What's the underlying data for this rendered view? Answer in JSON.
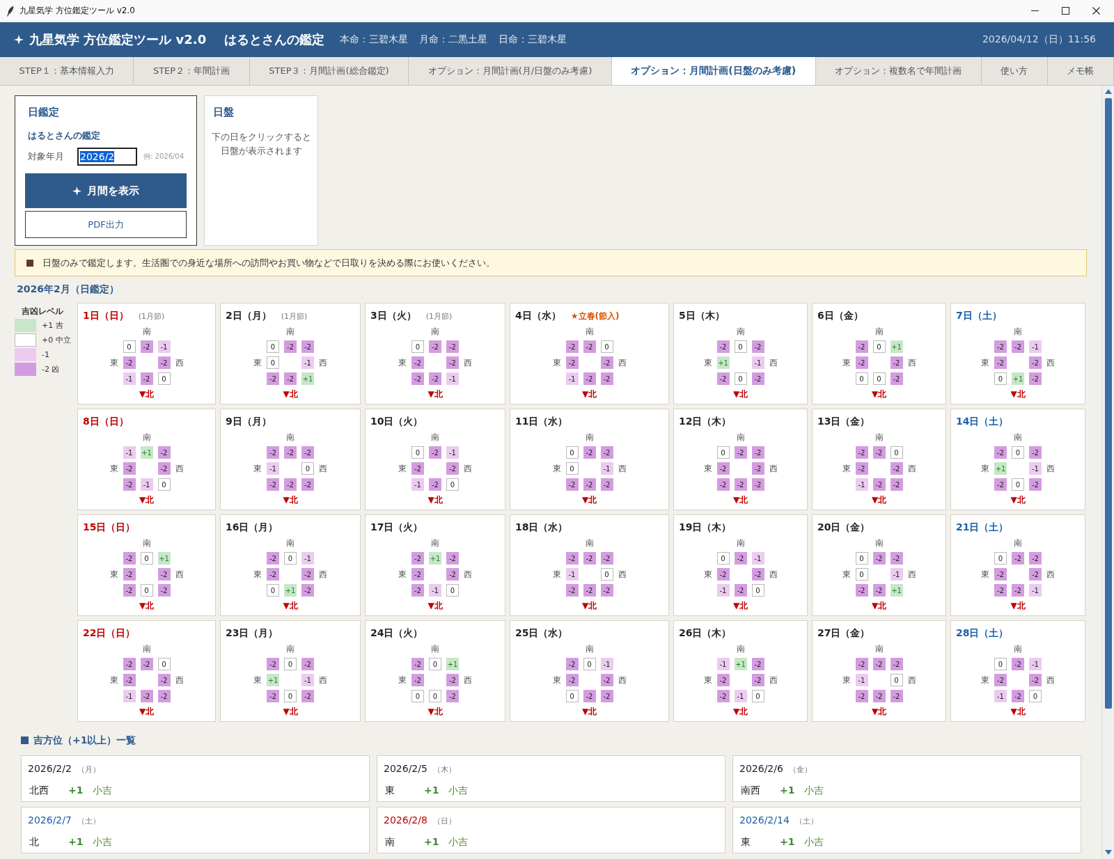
{
  "window": {
    "title": "九星気学 方位鑑定ツール v2.0"
  },
  "header": {
    "app_title": "九星気学 方位鑑定ツール v2.0",
    "subject": "はるとさんの鑑定",
    "stars": [
      "本命：三碧木星",
      "月命：二黒土星",
      "日命：三碧木星"
    ],
    "datetime": "2026/04/12（日）11:56"
  },
  "tabs": [
    {
      "label": "STEP１：基本情報入力",
      "selected": false
    },
    {
      "label": "STEP２：年間計画",
      "selected": false
    },
    {
      "label": "STEP３：月間計画(総合鑑定)",
      "selected": false
    },
    {
      "label": "オプション：月間計画(月/日盤のみ考慮)",
      "selected": false
    },
    {
      "label": "オプション：月間計画(日盤のみ考慮)",
      "selected": true
    },
    {
      "label": "オプション：複数名で年間計画",
      "selected": false
    },
    {
      "label": "使い方",
      "selected": false
    },
    {
      "label": "メモ帳",
      "selected": false
    }
  ],
  "control_panel": {
    "title": "日鑑定",
    "subject": "はるとさんの鑑定",
    "month_label": "対象年月",
    "month_value": "2026/2",
    "text_selected": true,
    "month_hint": "例: 2026/04",
    "buttons": [
      {
        "label": "月間を表示",
        "kind": "primary"
      },
      {
        "label": "PDF出力",
        "kind": "secondary"
      }
    ]
  },
  "board_panel": {
    "title": "日盤",
    "message_lines": [
      "下の日をクリックすると",
      "日盤が表示されます"
    ]
  },
  "notice": "日盤のみで鑑定します。生活圏での身近な場所への訪問やお買い物などで日取りを決める際にお使いください。",
  "calendar": {
    "title": "2026年2月（日鑑定）",
    "legend": {
      "title": "吉凶レベル",
      "items": [
        {
          "label": "+1 吉",
          "kind": "good"
        },
        {
          "label": "+0 中立",
          "kind": "neutral"
        },
        {
          "label": "-1",
          "kind": "minor"
        },
        {
          "label": "-2 凶",
          "kind": "bad"
        }
      ]
    },
    "days": [
      {
        "label": "1日（日）",
        "kind": "sunday",
        "note": {
          "text": "(1月節)",
          "kind": "period"
        },
        "south": "南",
        "east": "東",
        "west": "西",
        "north": "▼北",
        "cells": [
          {
            "text": "0",
            "kind": "neutral"
          },
          {
            "text": "-2",
            "kind": "bad"
          },
          {
            "text": "-1",
            "kind": "minor"
          },
          {
            "text": "-2",
            "kind": "bad"
          },
          {
            "text": "-2",
            "kind": "bad"
          },
          {
            "text": "-1",
            "kind": "minor"
          },
          {
            "text": "-2",
            "kind": "bad"
          },
          {
            "text": "0",
            "kind": "neutral"
          }
        ]
      },
      {
        "label": "2日（月）",
        "kind": "weekday",
        "note": {
          "text": "(1月節)",
          "kind": "period"
        },
        "south": "南",
        "east": "東",
        "west": "西",
        "north": "▼北",
        "cells": [
          {
            "text": "0",
            "kind": "neutral"
          },
          {
            "text": "-2",
            "kind": "bad"
          },
          {
            "text": "-2",
            "kind": "bad"
          },
          {
            "text": "0",
            "kind": "neutral"
          },
          {
            "text": "-1",
            "kind": "minor"
          },
          {
            "text": "-2",
            "kind": "bad"
          },
          {
            "text": "-2",
            "kind": "bad"
          },
          {
            "text": "+1",
            "kind": "good"
          }
        ]
      },
      {
        "label": "3日（火）",
        "kind": "weekday",
        "note": {
          "text": "(1月節)",
          "kind": "period"
        },
        "south": "南",
        "east": "東",
        "west": "西",
        "north": "▼北",
        "cells": [
          {
            "text": "0",
            "kind": "neutral"
          },
          {
            "text": "-2",
            "kind": "bad"
          },
          {
            "text": "-2",
            "kind": "bad"
          },
          {
            "text": "-2",
            "kind": "bad"
          },
          {
            "text": "-2",
            "kind": "bad"
          },
          {
            "text": "-2",
            "kind": "bad"
          },
          {
            "text": "-2",
            "kind": "bad"
          },
          {
            "text": "-1",
            "kind": "minor"
          }
        ]
      },
      {
        "label": "4日（水）",
        "kind": "weekday",
        "note": {
          "text": "★立春(節入)",
          "kind": "event"
        },
        "south": "南",
        "east": "東",
        "west": "西",
        "north": "▼北",
        "cells": [
          {
            "text": "-2",
            "kind": "bad"
          },
          {
            "text": "-2",
            "kind": "bad"
          },
          {
            "text": "0",
            "kind": "neutral"
          },
          {
            "text": "-2",
            "kind": "bad"
          },
          {
            "text": "-2",
            "kind": "bad"
          },
          {
            "text": "-1",
            "kind": "minor"
          },
          {
            "text": "-2",
            "kind": "bad"
          },
          {
            "text": "-2",
            "kind": "bad"
          }
        ]
      },
      {
        "label": "5日（木）",
        "kind": "weekday",
        "south": "南",
        "east": "東",
        "west": "西",
        "north": "▼北",
        "cells": [
          {
            "text": "-2",
            "kind": "bad"
          },
          {
            "text": "0",
            "kind": "neutral"
          },
          {
            "text": "-2",
            "kind": "bad"
          },
          {
            "text": "+1",
            "kind": "good"
          },
          {
            "text": "-1",
            "kind": "minor"
          },
          {
            "text": "-2",
            "kind": "bad"
          },
          {
            "text": "0",
            "kind": "neutral"
          },
          {
            "text": "-2",
            "kind": "bad"
          }
        ]
      },
      {
        "label": "6日（金）",
        "kind": "weekday",
        "south": "南",
        "east": "東",
        "west": "西",
        "north": "▼北",
        "cells": [
          {
            "text": "-2",
            "kind": "bad"
          },
          {
            "text": "0",
            "kind": "neutral"
          },
          {
            "text": "+1",
            "kind": "good"
          },
          {
            "text": "-2",
            "kind": "bad"
          },
          {
            "text": "-2",
            "kind": "bad"
          },
          {
            "text": "0",
            "kind": "neutral"
          },
          {
            "text": "0",
            "kind": "neutral"
          },
          {
            "text": "-2",
            "kind": "bad"
          }
        ]
      },
      {
        "label": "7日（土）",
        "kind": "saturday",
        "south": "南",
        "east": "東",
        "west": "西",
        "north": "▼北",
        "cells": [
          {
            "text": "-2",
            "kind": "bad"
          },
          {
            "text": "-2",
            "kind": "bad"
          },
          {
            "text": "-1",
            "kind": "minor"
          },
          {
            "text": "-2",
            "kind": "bad"
          },
          {
            "text": "-2",
            "kind": "bad"
          },
          {
            "text": "0",
            "kind": "neutral"
          },
          {
            "text": "+1",
            "kind": "good"
          },
          {
            "text": "-2",
            "kind": "bad"
          }
        ]
      },
      {
        "label": "8日（日）",
        "kind": "sunday",
        "south": "南",
        "east": "東",
        "west": "西",
        "north": "▼北",
        "cells": [
          {
            "text": "-1",
            "kind": "minor"
          },
          {
            "text": "+1",
            "kind": "good"
          },
          {
            "text": "-2",
            "kind": "bad"
          },
          {
            "text": "-2",
            "kind": "bad"
          },
          {
            "text": "-2",
            "kind": "bad"
          },
          {
            "text": "-2",
            "kind": "bad"
          },
          {
            "text": "-1",
            "kind": "minor"
          },
          {
            "text": "0",
            "kind": "neutral"
          }
        ]
      },
      {
        "label": "9日（月）",
        "kind": "weekday",
        "south": "南",
        "east": "東",
        "west": "西",
        "north": "▼北",
        "cells": [
          {
            "text": "-2",
            "kind": "bad"
          },
          {
            "text": "-2",
            "kind": "bad"
          },
          {
            "text": "-2",
            "kind": "bad"
          },
          {
            "text": "-1",
            "kind": "minor"
          },
          {
            "text": "0",
            "kind": "neutral"
          },
          {
            "text": "-2",
            "kind": "bad"
          },
          {
            "text": "-2",
            "kind": "bad"
          },
          {
            "text": "-2",
            "kind": "bad"
          }
        ]
      },
      {
        "label": "10日（火）",
        "kind": "weekday",
        "south": "南",
        "east": "東",
        "west": "西",
        "north": "▼北",
        "cells": [
          {
            "text": "0",
            "kind": "neutral"
          },
          {
            "text": "-2",
            "kind": "bad"
          },
          {
            "text": "-1",
            "kind": "minor"
          },
          {
            "text": "-2",
            "kind": "bad"
          },
          {
            "text": "-2",
            "kind": "bad"
          },
          {
            "text": "-1",
            "kind": "minor"
          },
          {
            "text": "-2",
            "kind": "bad"
          },
          {
            "text": "0",
            "kind": "neutral"
          }
        ]
      },
      {
        "label": "11日（水）",
        "kind": "weekday",
        "south": "南",
        "east": "東",
        "west": "西",
        "north": "▼北",
        "cells": [
          {
            "text": "0",
            "kind": "neutral"
          },
          {
            "text": "-2",
            "kind": "bad"
          },
          {
            "text": "-2",
            "kind": "bad"
          },
          {
            "text": "0",
            "kind": "neutral"
          },
          {
            "text": "-1",
            "kind": "minor"
          },
          {
            "text": "-2",
            "kind": "bad"
          },
          {
            "text": "-2",
            "kind": "bad"
          },
          {
            "text": "-2",
            "kind": "bad"
          }
        ]
      },
      {
        "label": "12日（木）",
        "kind": "weekday",
        "south": "南",
        "east": "東",
        "west": "西",
        "north": "▼北",
        "cells": [
          {
            "text": "0",
            "kind": "neutral"
          },
          {
            "text": "-2",
            "kind": "bad"
          },
          {
            "text": "-2",
            "kind": "bad"
          },
          {
            "text": "-2",
            "kind": "bad"
          },
          {
            "text": "-2",
            "kind": "bad"
          },
          {
            "text": "-2",
            "kind": "bad"
          },
          {
            "text": "-2",
            "kind": "bad"
          },
          {
            "text": "-2",
            "kind": "bad"
          }
        ]
      },
      {
        "label": "13日（金）",
        "kind": "weekday",
        "south": "南",
        "east": "東",
        "west": "西",
        "north": "▼北",
        "cells": [
          {
            "text": "-2",
            "kind": "bad"
          },
          {
            "text": "-2",
            "kind": "bad"
          },
          {
            "text": "0",
            "kind": "neutral"
          },
          {
            "text": "-2",
            "kind": "bad"
          },
          {
            "text": "-2",
            "kind": "bad"
          },
          {
            "text": "-1",
            "kind": "minor"
          },
          {
            "text": "-2",
            "kind": "bad"
          },
          {
            "text": "-2",
            "kind": "bad"
          }
        ]
      },
      {
        "label": "14日（土）",
        "kind": "saturday",
        "south": "南",
        "east": "東",
        "west": "西",
        "north": "▼北",
        "cells": [
          {
            "text": "-2",
            "kind": "bad"
          },
          {
            "text": "0",
            "kind": "neutral"
          },
          {
            "text": "-2",
            "kind": "bad"
          },
          {
            "text": "+1",
            "kind": "good"
          },
          {
            "text": "-1",
            "kind": "minor"
          },
          {
            "text": "-2",
            "kind": "bad"
          },
          {
            "text": "0",
            "kind": "neutral"
          },
          {
            "text": "-2",
            "kind": "bad"
          }
        ]
      },
      {
        "label": "15日（日）",
        "kind": "sunday",
        "south": "南",
        "east": "東",
        "west": "西",
        "north": "▼北",
        "cells": [
          {
            "text": "-2",
            "kind": "bad"
          },
          {
            "text": "0",
            "kind": "neutral"
          },
          {
            "text": "+1",
            "kind": "good"
          },
          {
            "text": "-2",
            "kind": "bad"
          },
          {
            "text": "-2",
            "kind": "bad"
          },
          {
            "text": "-2",
            "kind": "bad"
          },
          {
            "text": "0",
            "kind": "neutral"
          },
          {
            "text": "-2",
            "kind": "bad"
          }
        ]
      },
      {
        "label": "16日（月）",
        "kind": "weekday",
        "south": "南",
        "east": "東",
        "west": "西",
        "north": "▼北",
        "cells": [
          {
            "text": "-2",
            "kind": "bad"
          },
          {
            "text": "0",
            "kind": "neutral"
          },
          {
            "text": "-1",
            "kind": "minor"
          },
          {
            "text": "-2",
            "kind": "bad"
          },
          {
            "text": "-2",
            "kind": "bad"
          },
          {
            "text": "0",
            "kind": "neutral"
          },
          {
            "text": "+1",
            "kind": "good"
          },
          {
            "text": "-2",
            "kind": "bad"
          }
        ]
      },
      {
        "label": "17日（火）",
        "kind": "weekday",
        "south": "南",
        "east": "東",
        "west": "西",
        "north": "▼北",
        "cells": [
          {
            "text": "-2",
            "kind": "bad"
          },
          {
            "text": "+1",
            "kind": "good"
          },
          {
            "text": "-2",
            "kind": "bad"
          },
          {
            "text": "-2",
            "kind": "bad"
          },
          {
            "text": "-2",
            "kind": "bad"
          },
          {
            "text": "-2",
            "kind": "bad"
          },
          {
            "text": "-1",
            "kind": "minor"
          },
          {
            "text": "0",
            "kind": "neutral"
          }
        ]
      },
      {
        "label": "18日（水）",
        "kind": "weekday",
        "south": "南",
        "east": "東",
        "west": "西",
        "north": "▼北",
        "cells": [
          {
            "text": "-2",
            "kind": "bad"
          },
          {
            "text": "-2",
            "kind": "bad"
          },
          {
            "text": "-2",
            "kind": "bad"
          },
          {
            "text": "-1",
            "kind": "minor"
          },
          {
            "text": "0",
            "kind": "neutral"
          },
          {
            "text": "-2",
            "kind": "bad"
          },
          {
            "text": "-2",
            "kind": "bad"
          },
          {
            "text": "-2",
            "kind": "bad"
          }
        ]
      },
      {
        "label": "19日（木）",
        "kind": "weekday",
        "south": "南",
        "east": "東",
        "west": "西",
        "north": "▼北",
        "cells": [
          {
            "text": "0",
            "kind": "neutral"
          },
          {
            "text": "-2",
            "kind": "bad"
          },
          {
            "text": "-1",
            "kind": "minor"
          },
          {
            "text": "-2",
            "kind": "bad"
          },
          {
            "text": "-2",
            "kind": "bad"
          },
          {
            "text": "-1",
            "kind": "minor"
          },
          {
            "text": "-2",
            "kind": "bad"
          },
          {
            "text": "0",
            "kind": "neutral"
          }
        ]
      },
      {
        "label": "20日（金）",
        "kind": "weekday",
        "south": "南",
        "east": "東",
        "west": "西",
        "north": "▼北",
        "cells": [
          {
            "text": "0",
            "kind": "neutral"
          },
          {
            "text": "-2",
            "kind": "bad"
          },
          {
            "text": "-2",
            "kind": "bad"
          },
          {
            "text": "0",
            "kind": "neutral"
          },
          {
            "text": "-1",
            "kind": "minor"
          },
          {
            "text": "-2",
            "kind": "bad"
          },
          {
            "text": "-2",
            "kind": "bad"
          },
          {
            "text": "+1",
            "kind": "good"
          }
        ]
      },
      {
        "label": "21日（土）",
        "kind": "saturday",
        "south": "南",
        "east": "東",
        "west": "西",
        "north": "▼北",
        "cells": [
          {
            "text": "0",
            "kind": "neutral"
          },
          {
            "text": "-2",
            "kind": "bad"
          },
          {
            "text": "-2",
            "kind": "bad"
          },
          {
            "text": "-2",
            "kind": "bad"
          },
          {
            "text": "-2",
            "kind": "bad"
          },
          {
            "text": "-2",
            "kind": "bad"
          },
          {
            "text": "-2",
            "kind": "bad"
          },
          {
            "text": "-1",
            "kind": "minor"
          }
        ]
      },
      {
        "label": "22日（日）",
        "kind": "sunday",
        "south": "南",
        "east": "東",
        "west": "西",
        "north": "▼北",
        "cells": [
          {
            "text": "-2",
            "kind": "bad"
          },
          {
            "text": "-2",
            "kind": "bad"
          },
          {
            "text": "0",
            "kind": "neutral"
          },
          {
            "text": "-2",
            "kind": "bad"
          },
          {
            "text": "-2",
            "kind": "bad"
          },
          {
            "text": "-1",
            "kind": "minor"
          },
          {
            "text": "-2",
            "kind": "bad"
          },
          {
            "text": "-2",
            "kind": "bad"
          }
        ]
      },
      {
        "label": "23日（月）",
        "kind": "weekday",
        "south": "南",
        "east": "東",
        "west": "西",
        "north": "▼北",
        "cells": [
          {
            "text": "-2",
            "kind": "bad"
          },
          {
            "text": "0",
            "kind": "neutral"
          },
          {
            "text": "-2",
            "kind": "bad"
          },
          {
            "text": "+1",
            "kind": "good"
          },
          {
            "text": "-1",
            "kind": "minor"
          },
          {
            "text": "-2",
            "kind": "bad"
          },
          {
            "text": "0",
            "kind": "neutral"
          },
          {
            "text": "-2",
            "kind": "bad"
          }
        ]
      },
      {
        "label": "24日（火）",
        "kind": "weekday",
        "south": "南",
        "east": "東",
        "west": "西",
        "north": "▼北",
        "cells": [
          {
            "text": "-2",
            "kind": "bad"
          },
          {
            "text": "0",
            "kind": "neutral"
          },
          {
            "text": "+1",
            "kind": "good"
          },
          {
            "text": "-2",
            "kind": "bad"
          },
          {
            "text": "-2",
            "kind": "bad"
          },
          {
            "text": "0",
            "kind": "neutral"
          },
          {
            "text": "0",
            "kind": "neutral"
          },
          {
            "text": "-2",
            "kind": "bad"
          }
        ]
      },
      {
        "label": "25日（水）",
        "kind": "weekday",
        "south": "南",
        "east": "東",
        "west": "西",
        "north": "▼北",
        "cells": [
          {
            "text": "-2",
            "kind": "bad"
          },
          {
            "text": "0",
            "kind": "neutral"
          },
          {
            "text": "-1",
            "kind": "minor"
          },
          {
            "text": "-2",
            "kind": "bad"
          },
          {
            "text": "-2",
            "kind": "bad"
          },
          {
            "text": "0",
            "kind": "neutral"
          },
          {
            "text": "-2",
            "kind": "bad"
          },
          {
            "text": "-2",
            "kind": "bad"
          }
        ]
      },
      {
        "label": "26日（木）",
        "kind": "weekday",
        "south": "南",
        "east": "東",
        "west": "西",
        "north": "▼北",
        "cells": [
          {
            "text": "-1",
            "kind": "minor"
          },
          {
            "text": "+1",
            "kind": "good"
          },
          {
            "text": "-2",
            "kind": "bad"
          },
          {
            "text": "-2",
            "kind": "bad"
          },
          {
            "text": "-2",
            "kind": "bad"
          },
          {
            "text": "-2",
            "kind": "bad"
          },
          {
            "text": "-1",
            "kind": "minor"
          },
          {
            "text": "0",
            "kind": "neutral"
          }
        ]
      },
      {
        "label": "27日（金）",
        "kind": "weekday",
        "south": "南",
        "east": "東",
        "west": "西",
        "north": "▼北",
        "cells": [
          {
            "text": "-2",
            "kind": "bad"
          },
          {
            "text": "-2",
            "kind": "bad"
          },
          {
            "text": "-2",
            "kind": "bad"
          },
          {
            "text": "-1",
            "kind": "minor"
          },
          {
            "text": "0",
            "kind": "neutral"
          },
          {
            "text": "-2",
            "kind": "bad"
          },
          {
            "text": "-2",
            "kind": "bad"
          },
          {
            "text": "-2",
            "kind": "bad"
          }
        ]
      },
      {
        "label": "28日（土）",
        "kind": "saturday",
        "south": "南",
        "east": "東",
        "west": "西",
        "north": "▼北",
        "cells": [
          {
            "text": "0",
            "kind": "neutral"
          },
          {
            "text": "-2",
            "kind": "bad"
          },
          {
            "text": "-1",
            "kind": "minor"
          },
          {
            "text": "-2",
            "kind": "bad"
          },
          {
            "text": "-2",
            "kind": "bad"
          },
          {
            "text": "-1",
            "kind": "minor"
          },
          {
            "text": "-2",
            "kind": "bad"
          },
          {
            "text": "0",
            "kind": "neutral"
          }
        ]
      }
    ]
  },
  "good_directions": {
    "title": "吉方位（+1以上）一覧",
    "items": [
      {
        "date": "2026/2/2",
        "weekday": "（月）",
        "kind": "weekday",
        "direction": "北西",
        "score": "+1",
        "rating": "小吉"
      },
      {
        "date": "2026/2/5",
        "weekday": "（木）",
        "kind": "weekday",
        "direction": "東",
        "score": "+1",
        "rating": "小吉"
      },
      {
        "date": "2026/2/6",
        "weekday": "（金）",
        "kind": "weekday",
        "direction": "南西",
        "score": "+1",
        "rating": "小吉"
      },
      {
        "date": "2026/2/7",
        "weekday": "（土）",
        "kind": "saturday",
        "direction": "北",
        "score": "+1",
        "rating": "小吉"
      },
      {
        "date": "2026/2/8",
        "weekday": "（日）",
        "kind": "sunday",
        "direction": "南",
        "score": "+1",
        "rating": "小吉"
      },
      {
        "date": "2026/2/14",
        "weekday": "（土）",
        "kind": "saturday",
        "direction": "東",
        "score": "+1",
        "rating": "小吉"
      }
    ]
  }
}
